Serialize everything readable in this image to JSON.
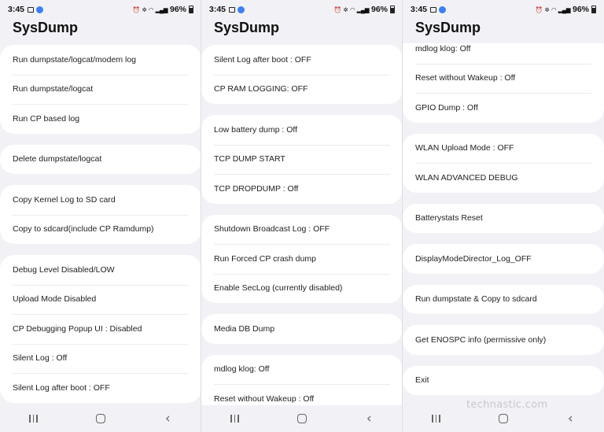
{
  "status": {
    "time": "3:45",
    "battery": "96%"
  },
  "app_title": "SysDump",
  "watermark": "technastic.com",
  "panels": [
    {
      "groups": [
        [
          "Run dumpstate/logcat/modem log",
          "Run dumpstate/logcat",
          "Run CP based log"
        ],
        [
          "Delete dumpstate/logcat"
        ],
        [
          "Copy Kernel Log to SD card",
          "Copy to sdcard(include CP Ramdump)"
        ],
        [
          "Debug Level Disabled/LOW",
          "Upload Mode Disabled",
          "CP Debugging Popup UI : Disabled",
          "Silent Log : Off",
          "Silent Log after boot : OFF"
        ]
      ]
    },
    {
      "groups": [
        [
          "Silent Log after boot : OFF",
          "CP RAM LOGGING: OFF"
        ],
        [
          "Low battery dump : Off",
          "TCP DUMP START",
          "TCP DROPDUMP : Off"
        ],
        [
          "Shutdown Broadcast Log : OFF",
          "Run Forced CP crash dump",
          "Enable SecLog (currently disabled)"
        ],
        [
          "Media DB Dump"
        ],
        [
          "mdlog klog: Off",
          "Reset without Wakeup : Off"
        ]
      ]
    },
    {
      "groups": [
        [
          "mdlog klog: Off",
          "Reset without Wakeup : Off",
          "GPIO Dump : Off"
        ],
        [
          "WLAN Upload Mode : OFF",
          "WLAN ADVANCED DEBUG"
        ],
        [
          "Batterystats Reset"
        ],
        [
          "DisplayModeDirector_Log_OFF"
        ],
        [
          "Run dumpstate & Copy to sdcard"
        ],
        [
          "Get ENOSPC info (permissive only)"
        ],
        [
          "Exit"
        ]
      ]
    }
  ],
  "icons": {
    "notification": "image-icon",
    "app": "blue-circle-icon",
    "alarm": "alarm-icon",
    "vibrate": "vibrate-icon",
    "wifi": "wifi-icon",
    "signal": "signal-icon",
    "battery": "battery-icon",
    "recent": "recent-apps-icon",
    "home": "home-icon",
    "back": "back-icon"
  }
}
